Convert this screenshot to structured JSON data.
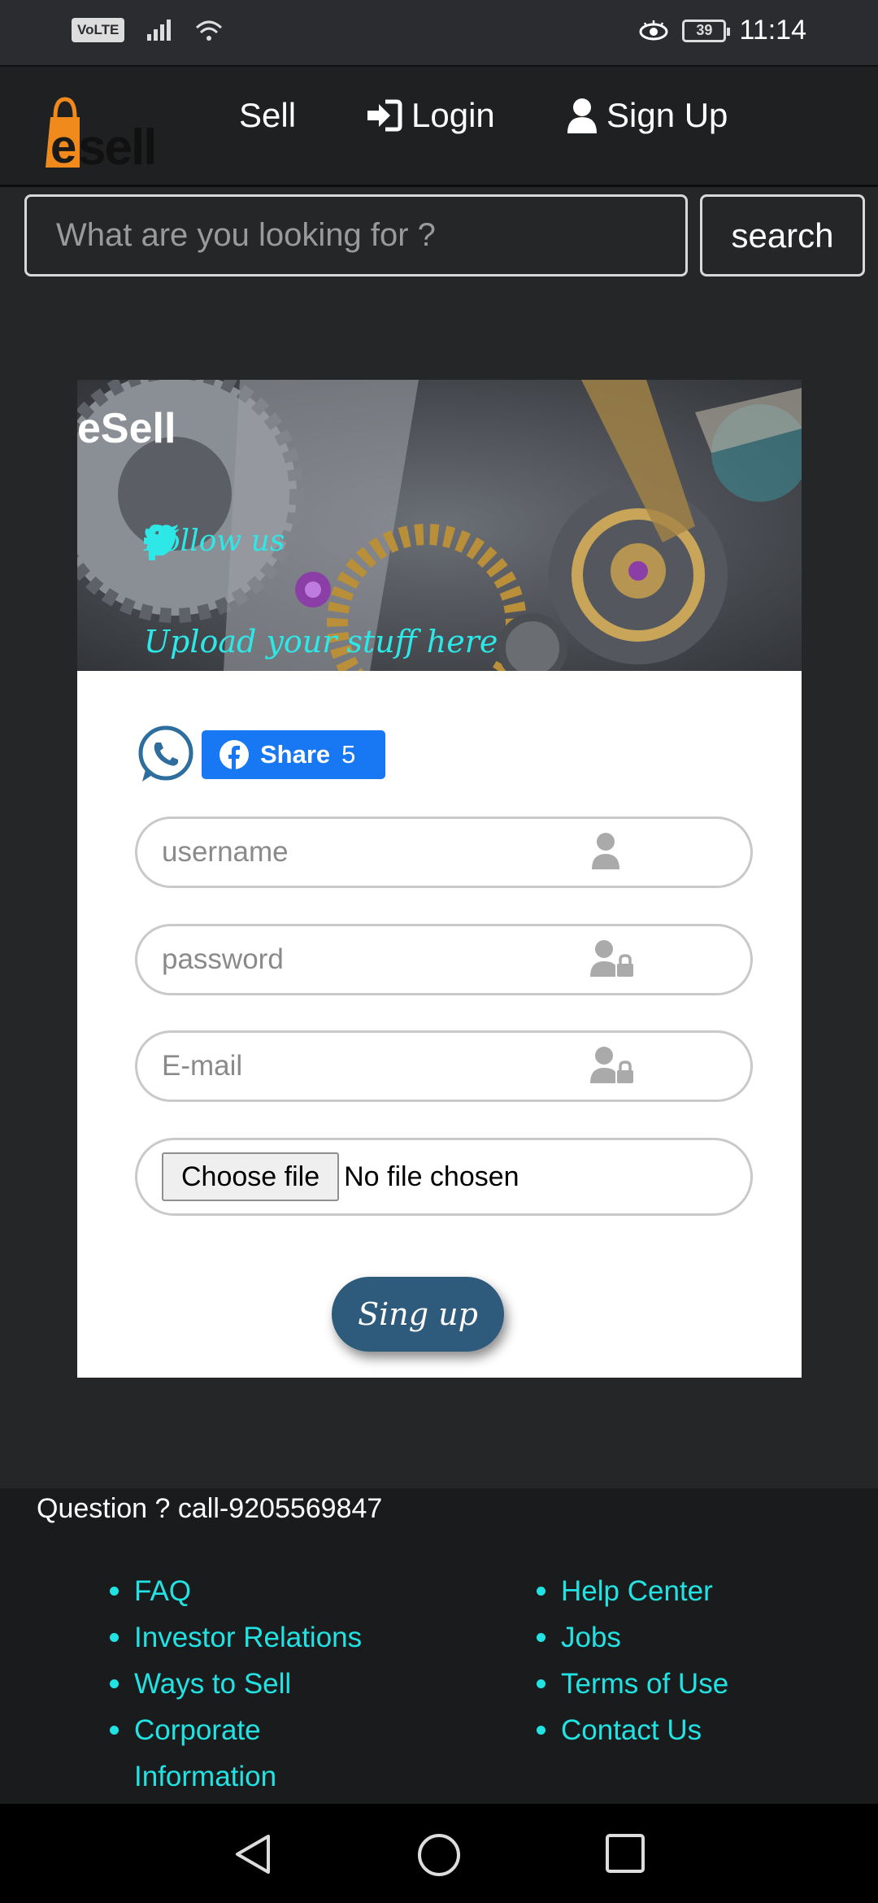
{
  "status_bar": {
    "network": "VoLTE",
    "battery": "39",
    "time": "11:14"
  },
  "nav": {
    "logo_text": "esell",
    "sell": "Sell",
    "login": "Login",
    "signup": "Sign Up"
  },
  "search": {
    "placeholder": "What are you looking for ?",
    "button": "search"
  },
  "banner": {
    "brand": "eSell",
    "follow": "Follow us",
    "upload": "Upload your stuff here"
  },
  "share": {
    "label": "Share",
    "count": "5"
  },
  "form": {
    "username_placeholder": "username",
    "password_placeholder": "password",
    "email_placeholder": "E-mail",
    "choose_file": "Choose file",
    "file_status": "No file chosen",
    "submit": "Sing up"
  },
  "footer": {
    "question": "Question ? call-9205569847",
    "left_links": [
      "FAQ",
      "Investor Relations",
      "Ways to Sell",
      "Corporate Information"
    ],
    "right_links": [
      "Help Center",
      "Jobs",
      "Terms of Use",
      "Contact Us"
    ]
  },
  "colors": {
    "accent_cyan": "#22e3e3",
    "button_blue": "#2e5b7c",
    "facebook_blue": "#1877f2",
    "logo_orange": "#f08a1c"
  }
}
